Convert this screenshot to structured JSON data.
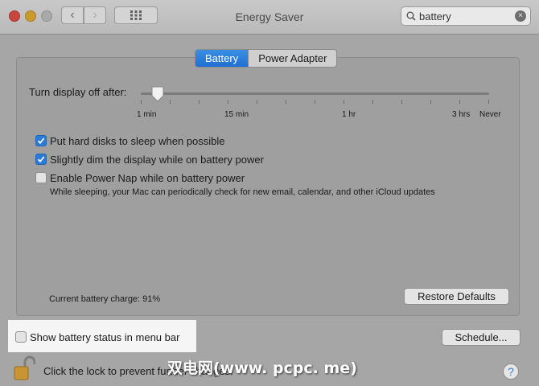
{
  "window": {
    "title": "Energy Saver"
  },
  "toolbar": {
    "back_glyph": "‹",
    "forward_glyph": "›",
    "search_value": "battery",
    "search_clear_glyph": "×"
  },
  "tabs": [
    {
      "label": "Battery",
      "selected": true
    },
    {
      "label": "Power Adapter",
      "selected": false
    }
  ],
  "display_sleep": {
    "label": "Turn display off after:",
    "value": "2 min",
    "tick_labels": [
      "1 min",
      "15 min",
      "1 hr",
      "3 hrs",
      "Never"
    ]
  },
  "options": [
    {
      "label": "Put hard disks to sleep when possible",
      "checked": true
    },
    {
      "label": "Slightly dim the display while on battery power",
      "checked": true
    },
    {
      "label": "Enable Power Nap while on battery power",
      "checked": false
    }
  ],
  "power_nap_description": "While sleeping, your Mac can periodically check for new email, calendar, and other iCloud updates",
  "battery_charge": "Current battery charge: 91%",
  "buttons": {
    "restore_defaults": "Restore Defaults",
    "schedule": "Schedule..."
  },
  "show_battery_status": {
    "label": "Show battery status in menu bar",
    "checked": false
  },
  "lock_text": "Click the lock to prevent further changes.",
  "watermark": "双电网(www. pcpc. me)",
  "help_glyph": "?",
  "icons": {
    "close": "close-button-icon",
    "minimize": "minimize-button-icon",
    "zoom": "zoom-button-icon",
    "grid": "show-all-grid-icon",
    "search": "search-icon",
    "lock": "padlock-icon",
    "help": "help-icon"
  },
  "colors": {
    "accent": "#2a7ad8",
    "close": "#c9463f",
    "minimize": "#c99b2c"
  }
}
